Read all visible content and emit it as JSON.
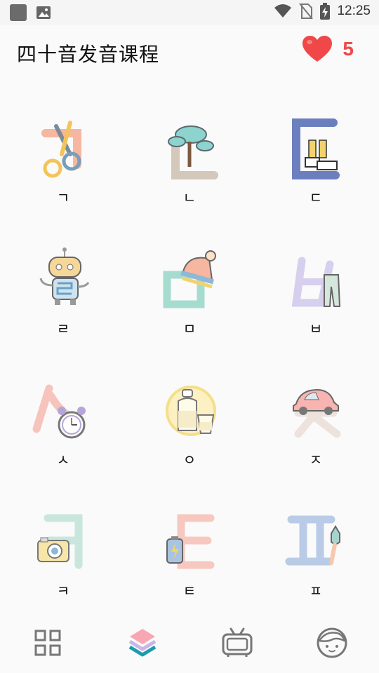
{
  "status_bar": {
    "time": "12:25"
  },
  "header": {
    "title": "四十音发音课程",
    "lives_count": "5"
  },
  "letters": [
    {
      "char": "ㄱ",
      "icon": "scissors-icon"
    },
    {
      "char": "ㄴ",
      "icon": "tree-icon"
    },
    {
      "char": "ㄷ",
      "icon": "sneakers-icon"
    },
    {
      "char": "ㄹ",
      "icon": "robot-icon"
    },
    {
      "char": "ㅁ",
      "icon": "beanie-hat-icon"
    },
    {
      "char": "ㅂ",
      "icon": "pants-icon"
    },
    {
      "char": "ㅅ",
      "icon": "alarm-clock-icon"
    },
    {
      "char": "ㅇ",
      "icon": "milk-icon"
    },
    {
      "char": "ㅈ",
      "icon": "car-icon"
    },
    {
      "char": "ㅋ",
      "icon": "camera-icon"
    },
    {
      "char": "ㅌ",
      "icon": "battery-icon"
    },
    {
      "char": "ㅍ",
      "icon": "fork-icon"
    }
  ],
  "bottom_nav": [
    "grid-icon",
    "layers-icon",
    "tv-icon",
    "profile-icon"
  ],
  "colors": {
    "heart": "#f04848",
    "active_tab_top": "#f7a6b2",
    "active_tab_bottom": "#1a9cae"
  }
}
